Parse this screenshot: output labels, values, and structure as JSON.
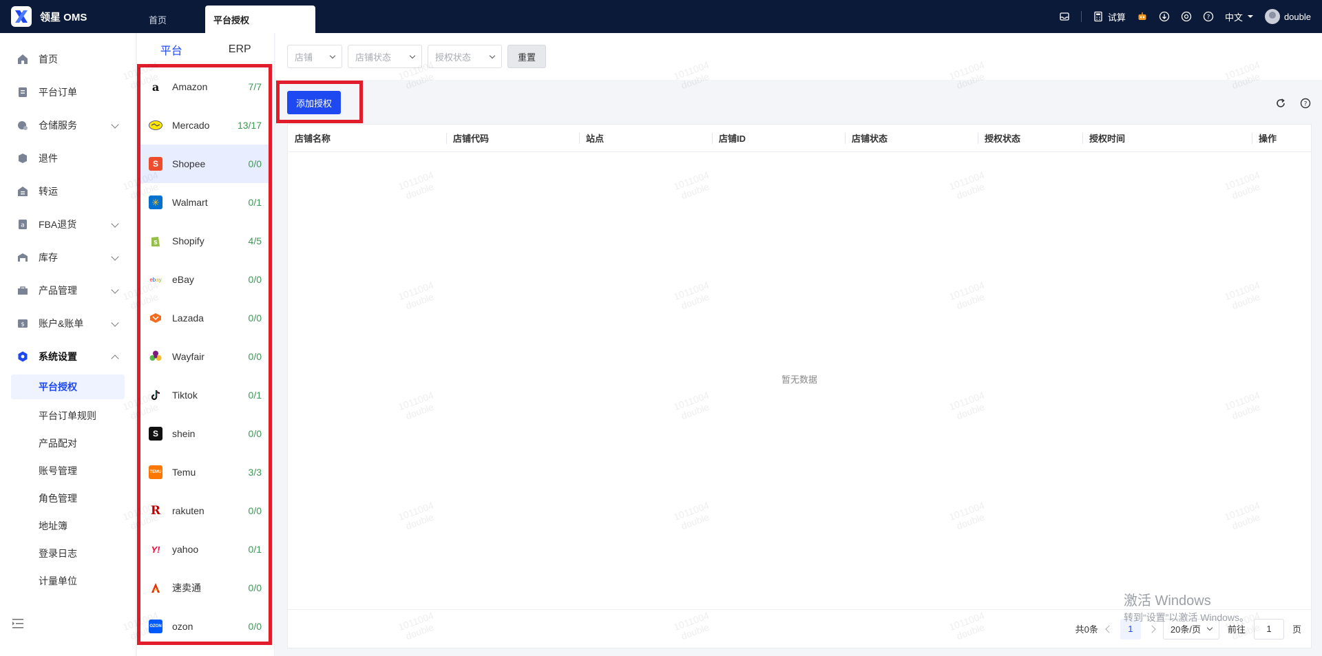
{
  "app": {
    "title": "领星 OMS"
  },
  "top_tabs": [
    {
      "label": "首页"
    },
    {
      "label": "平台授权"
    }
  ],
  "top_right": {
    "calc_label": "试算",
    "language": "中文",
    "username": "double"
  },
  "nav": {
    "items": [
      {
        "label": "首页"
      },
      {
        "label": "平台订单"
      },
      {
        "label": "仓储服务"
      },
      {
        "label": "退件"
      },
      {
        "label": "转运"
      },
      {
        "label": "FBA退货"
      },
      {
        "label": "库存"
      },
      {
        "label": "产品管理"
      },
      {
        "label": "账户&账单"
      },
      {
        "label": "系统设置"
      }
    ],
    "sub_items": [
      {
        "label": "平台授权"
      },
      {
        "label": "平台订单规则"
      },
      {
        "label": "产品配对"
      },
      {
        "label": "账号管理"
      },
      {
        "label": "角色管理"
      },
      {
        "label": "地址簿"
      },
      {
        "label": "登录日志"
      },
      {
        "label": "计量单位"
      }
    ]
  },
  "platform_panel": {
    "tabs": [
      {
        "label": "平台"
      },
      {
        "label": "ERP"
      }
    ],
    "platforms": [
      {
        "name": "Amazon",
        "count": "7/7"
      },
      {
        "name": "Mercado",
        "count": "13/17"
      },
      {
        "name": "Shopee",
        "count": "0/0"
      },
      {
        "name": "Walmart",
        "count": "0/1"
      },
      {
        "name": "Shopify",
        "count": "4/5"
      },
      {
        "name": "eBay",
        "count": "0/0"
      },
      {
        "name": "Lazada",
        "count": "0/0"
      },
      {
        "name": "Wayfair",
        "count": "0/0"
      },
      {
        "name": "Tiktok",
        "count": "0/1"
      },
      {
        "name": "shein",
        "count": "0/0"
      },
      {
        "name": "Temu",
        "count": "3/3"
      },
      {
        "name": "rakuten",
        "count": "0/0"
      },
      {
        "name": "yahoo",
        "count": "0/1"
      },
      {
        "name": "速卖通",
        "count": "0/0"
      },
      {
        "name": "ozon",
        "count": "0/0"
      }
    ]
  },
  "filters": {
    "store_placeholder": "店铺",
    "store_status_placeholder": "店铺状态",
    "auth_status_placeholder": "授权状态",
    "reset_label": "重置"
  },
  "actions": {
    "add_auth_label": "添加授权"
  },
  "table": {
    "columns": [
      "店铺名称",
      "店铺代码",
      "站点",
      "店铺ID",
      "店铺状态",
      "授权状态",
      "授权时间",
      "操作"
    ],
    "empty_text": "暂无数据"
  },
  "pagination": {
    "total": "共0条",
    "current_page": "1",
    "page_size": "20条/页",
    "goto_label": "前往",
    "goto_value": "1",
    "page_suffix": "页"
  },
  "watermark": {
    "line1": "1011004",
    "line2": "double"
  },
  "os_overlay": {
    "line1": "激活 Windows",
    "line2": "转到“设置”以激活 Windows。"
  },
  "colors": {
    "accent": "#1e48f0",
    "topbar": "#0c1a3a",
    "highlight_border": "#e11d2b",
    "count_green": "#3a9a52"
  }
}
